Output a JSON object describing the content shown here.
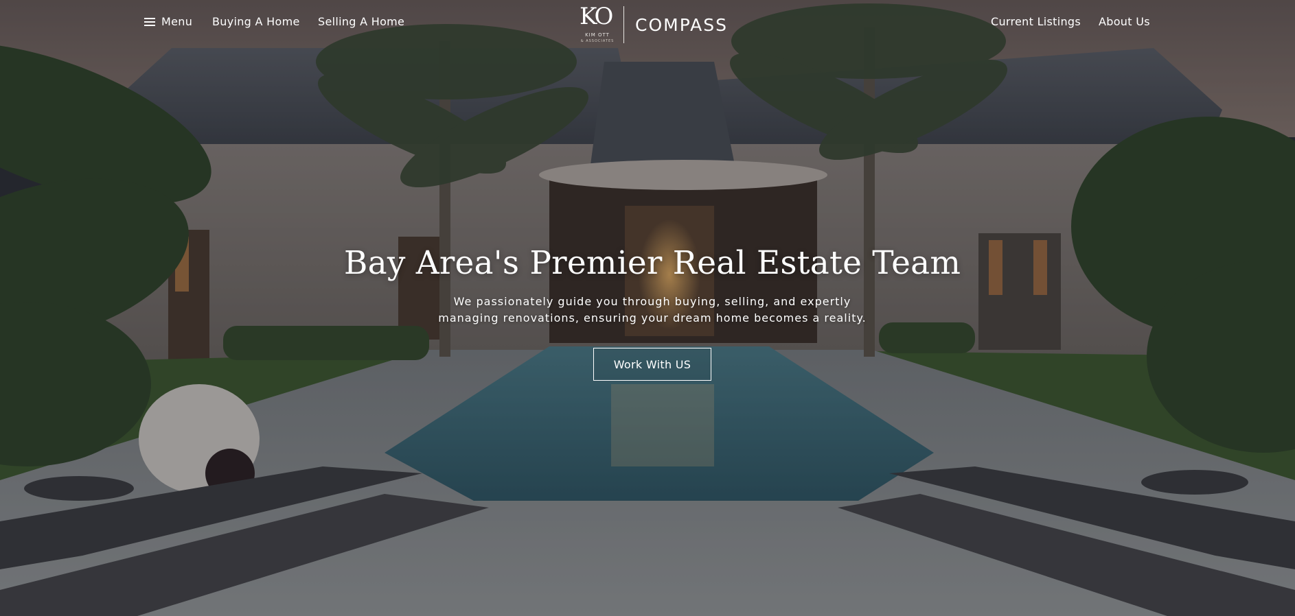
{
  "nav": {
    "menu_label": "Menu",
    "buying_label": "Buying A Home",
    "selling_label": "Selling A Home",
    "listings_label": "Current Listings",
    "about_label": "About Us"
  },
  "brand": {
    "logo_monogram": "KO",
    "logo_name": "KIM OTT",
    "logo_tagline": "& ASSOCIATES",
    "compass_wordmark": "COMPASS"
  },
  "hero": {
    "headline": "Bay Area's Premier Real Estate Team",
    "subtext_line1": "We passionately guide you through buying, selling, and expertly",
    "subtext_line2": "managing renovations, ensuring your dream home becomes a reality.",
    "cta_label": "Work With US"
  },
  "icons": {
    "menu": "hamburger-icon"
  },
  "colors": {
    "text": "#ffffff",
    "overlay": "#141419"
  }
}
